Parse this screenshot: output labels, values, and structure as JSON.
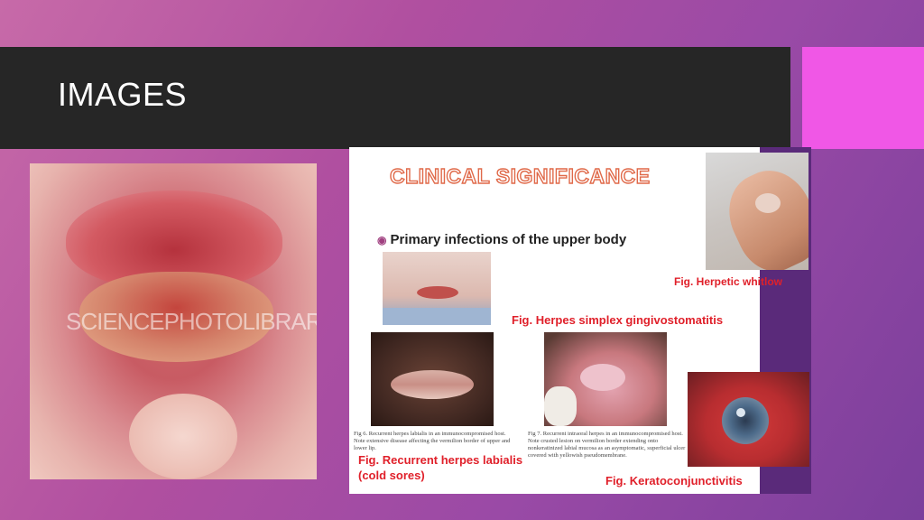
{
  "slide": {
    "title": "IMAGES",
    "left_photo_watermark": "SCIENCEPHOTOLIBRARY"
  },
  "panel": {
    "heading": "CLINICAL SIGNIFICANCE",
    "bullet": "Primary infections of the upper body",
    "captions": {
      "herpetic_whitlow": "Fig. Herpetic whitlow",
      "gingivostomatitis": "Fig. Herpes simplex gingivostomatitis",
      "labialis_line1": "Fig. Recurrent herpes labialis",
      "labialis_line2": "(cold sores)",
      "keratoconjunctivitis": "Fig. Keratoconjunctivitis"
    },
    "fig6_text": "Fig 6. Recurrent herpes labialis in an immunocompromised host. Note extensive disease affecting the vermilion border of upper and lower lip.",
    "fig7_text": "Fig 7. Recurrent intraoral herpes in an immunocompromised host. Note crusted lesion on vermilion border extending onto nonkeratinized labial mucosa as an asymptomatic, superficial ulcer covered with yellowish pseudomembrane."
  },
  "colors": {
    "background": "#b04fa0",
    "titlebar": "#262626",
    "accent": "#f057e6",
    "caption_red": "#e0202a"
  }
}
